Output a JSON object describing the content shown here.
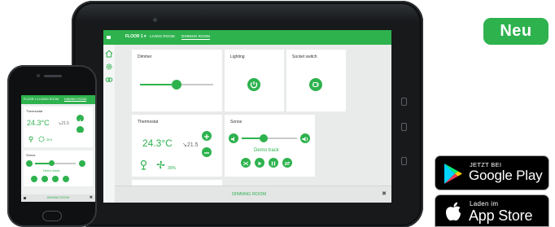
{
  "badge": {
    "label": "Neu",
    "color": "#2eb24e"
  },
  "google_play": {
    "small": "JETZT BEI",
    "big": "Google Play"
  },
  "app_store": {
    "small": "Laden im",
    "big": "App Store"
  },
  "tablet": {
    "tabs": [
      {
        "label": "FLOOR 1 ▾",
        "active": false
      },
      {
        "label": "LIVING ROOM",
        "active": false
      },
      {
        "label": "DINNING ROOM",
        "active": true
      }
    ],
    "sidebar_icons": [
      "home-icon",
      "gear-icon",
      "link-icon"
    ],
    "dimmer": {
      "title": "Dimmer",
      "level": 0.5
    },
    "lighting": {
      "title": "Lighting"
    },
    "socket": {
      "title": "Socket switch"
    },
    "thermostat": {
      "title": "Thermostat",
      "temp": "24.3°C",
      "target": "↘21.5",
      "fan": "30%"
    },
    "sonos": {
      "title": "Sonos",
      "track": "Demo track",
      "volume": 0.4
    },
    "bottom_label": "DINNING ROOM",
    "close": "✖"
  },
  "phone": {
    "tabs": [
      {
        "label": "FLOOR 1 ▾",
        "active": false
      },
      {
        "label": "LIVING ROOM",
        "active": false
      },
      {
        "label": "DINNING ROOM",
        "active": true
      }
    ],
    "thermostat": {
      "title": "Thermostat",
      "temp": "24.3°C",
      "target": "↘21.5",
      "fan": "30%"
    },
    "sonos": {
      "title": "Sonos",
      "track": "Demo track",
      "volume": 0.4
    },
    "bottom_label": "DINNING ROOM",
    "close": "✖"
  },
  "colors": {
    "accent": "#2eb24e",
    "device": "#17191b",
    "screen_bg": "#e9eaea"
  }
}
